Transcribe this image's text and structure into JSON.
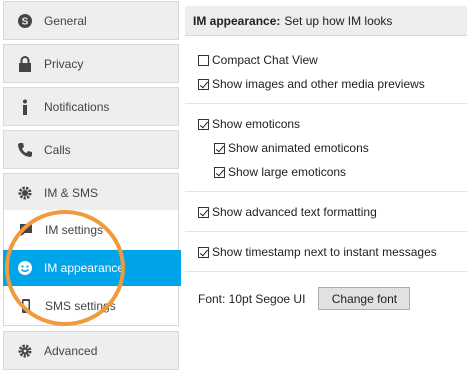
{
  "sidebar": {
    "categories": [
      {
        "label": "General",
        "icon": "skype-icon"
      },
      {
        "label": "Privacy",
        "icon": "lock-icon"
      },
      {
        "label": "Notifications",
        "icon": "info-icon"
      },
      {
        "label": "Calls",
        "icon": "phone-icon"
      },
      {
        "label": "IM & SMS",
        "icon": "chat-gear-icon"
      },
      {
        "label": "Advanced",
        "icon": "gear-icon"
      }
    ],
    "subitems": [
      {
        "label": "IM settings",
        "icon": "chat-bubble-icon"
      },
      {
        "label": "IM appearance",
        "icon": "smiley-icon",
        "active": true
      },
      {
        "label": "SMS settings",
        "icon": "mobile-icon"
      }
    ]
  },
  "panel": {
    "header_bold": "IM appearance:",
    "header_rest": "Set up how IM looks",
    "options": [
      {
        "label": "Compact Chat View",
        "checked": false
      },
      {
        "label": "Show images and other media previews",
        "checked": true
      },
      {
        "label": "Show emoticons",
        "checked": true
      },
      {
        "label": "Show animated emoticons",
        "checked": true
      },
      {
        "label": "Show large emoticons",
        "checked": true
      },
      {
        "label": "Show advanced text formatting",
        "checked": true
      },
      {
        "label": "Show timestamp next to instant messages",
        "checked": true
      }
    ],
    "font_label": "Font: 10pt Segoe UI",
    "change_font_button": "Change font"
  },
  "colors": {
    "active_item": "#00a4e8",
    "highlight_circle": "#ef9a3c"
  }
}
